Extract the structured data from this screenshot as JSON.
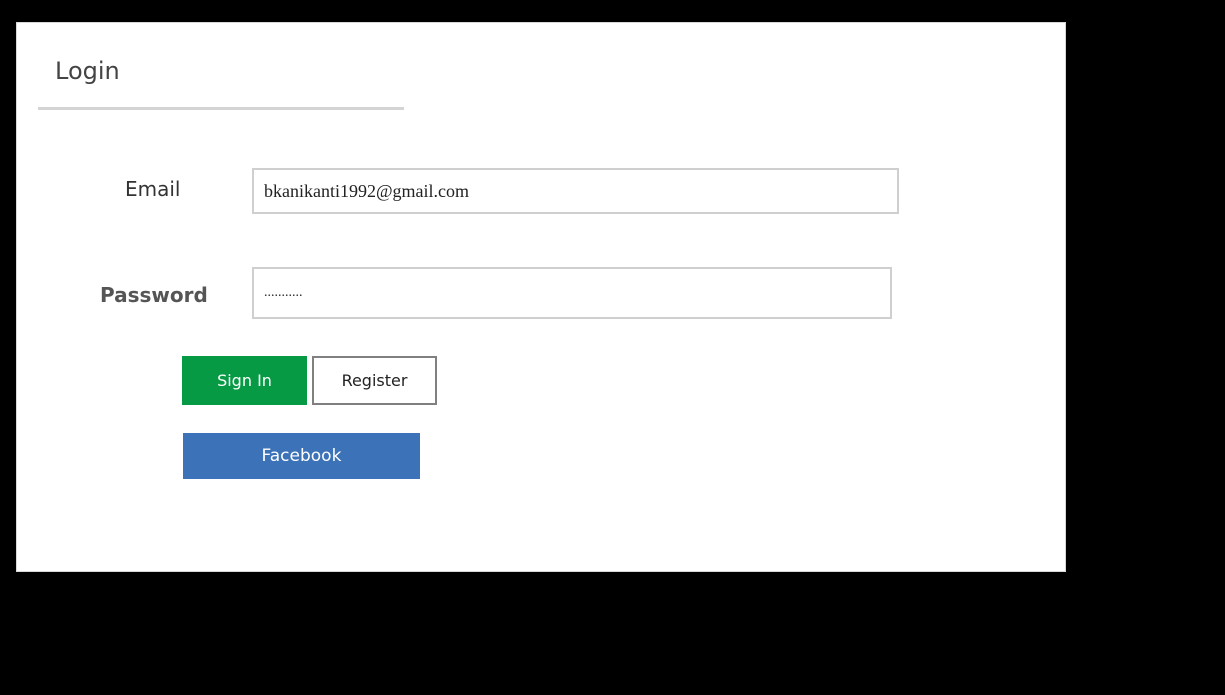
{
  "login": {
    "title": "Login",
    "email": {
      "label": "Email",
      "value": "bkanikanti1992@gmail.com"
    },
    "password": {
      "label": "Password",
      "value": "..........."
    },
    "buttons": {
      "sign_in": "Sign In",
      "register": "Register",
      "facebook": "Facebook"
    }
  },
  "colors": {
    "background": "#000000",
    "panel": "#ffffff",
    "sign_in": "#079a44",
    "facebook": "#3c72b8",
    "register_border": "#808080"
  }
}
